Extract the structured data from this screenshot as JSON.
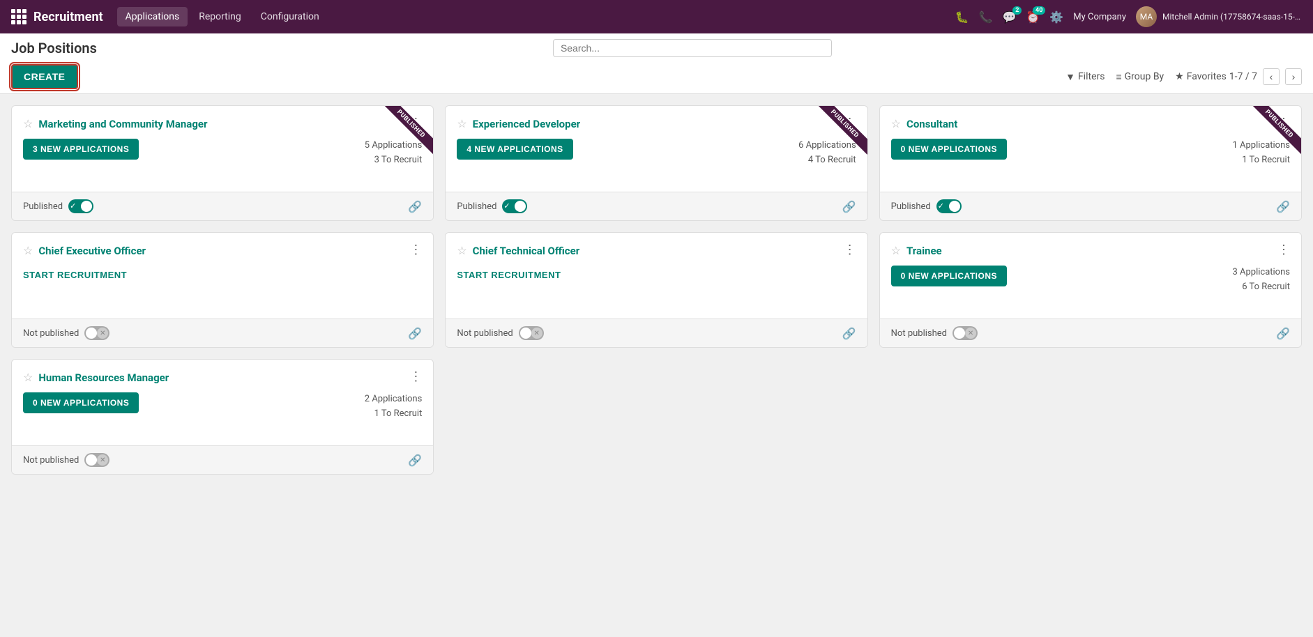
{
  "app": {
    "name": "Recruitment",
    "menu": [
      {
        "label": "Applications",
        "active": true
      },
      {
        "label": "Reporting"
      },
      {
        "label": "Configuration"
      }
    ]
  },
  "topnav": {
    "company": "My Company",
    "user": "Mitchell Admin (17758674-saas-15-2-all",
    "badges": {
      "chat": "2",
      "activity": "40"
    }
  },
  "page": {
    "title": "Job Positions",
    "search_placeholder": "Search...",
    "create_label": "CREATE",
    "toolbar": {
      "filters": "Filters",
      "group_by": "Group By",
      "favorites": "Favorites",
      "pagination": "1-7 / 7"
    }
  },
  "cards": [
    {
      "id": "marketing",
      "title": "Marketing and Community Manager",
      "published": true,
      "ribbon": "PUBLISHED",
      "new_apps_label": "3 NEW APPLICATIONS",
      "applications": "5 Applications",
      "to_recruit": "3 To Recruit",
      "status_label": "Published",
      "has_apps": true
    },
    {
      "id": "developer",
      "title": "Experienced Developer",
      "published": true,
      "ribbon": "PUBLISHED",
      "new_apps_label": "4 NEW APPLICATIONS",
      "applications": "6 Applications",
      "to_recruit": "4 To Recruit",
      "status_label": "Published",
      "has_apps": true
    },
    {
      "id": "consultant",
      "title": "Consultant",
      "published": true,
      "ribbon": "PUBLISHED",
      "new_apps_label": "0 NEW APPLICATIONS",
      "applications": "1 Applications",
      "to_recruit": "1 To Recruit",
      "status_label": "Published",
      "has_apps": true
    },
    {
      "id": "ceo",
      "title": "Chief Executive Officer",
      "published": false,
      "ribbon": null,
      "new_apps_label": null,
      "start_recruit_label": "START RECRUITMENT",
      "applications": null,
      "to_recruit": null,
      "status_label": "Not published",
      "has_apps": false
    },
    {
      "id": "cto",
      "title": "Chief Technical Officer",
      "published": false,
      "ribbon": null,
      "new_apps_label": null,
      "start_recruit_label": "START RECRUITMENT",
      "applications": null,
      "to_recruit": null,
      "status_label": "Not published",
      "has_apps": false
    },
    {
      "id": "trainee",
      "title": "Trainee",
      "published": false,
      "ribbon": null,
      "new_apps_label": "0 NEW APPLICATIONS",
      "applications": "3 Applications",
      "to_recruit": "6 To Recruit",
      "status_label": "Not published",
      "has_apps": true
    },
    {
      "id": "hr-manager",
      "title": "Human Resources Manager",
      "published": false,
      "ribbon": null,
      "new_apps_label": "0 NEW APPLICATIONS",
      "applications": "2 Applications",
      "to_recruit": "1 To Recruit",
      "status_label": "Not published",
      "has_apps": true,
      "single": true
    }
  ]
}
